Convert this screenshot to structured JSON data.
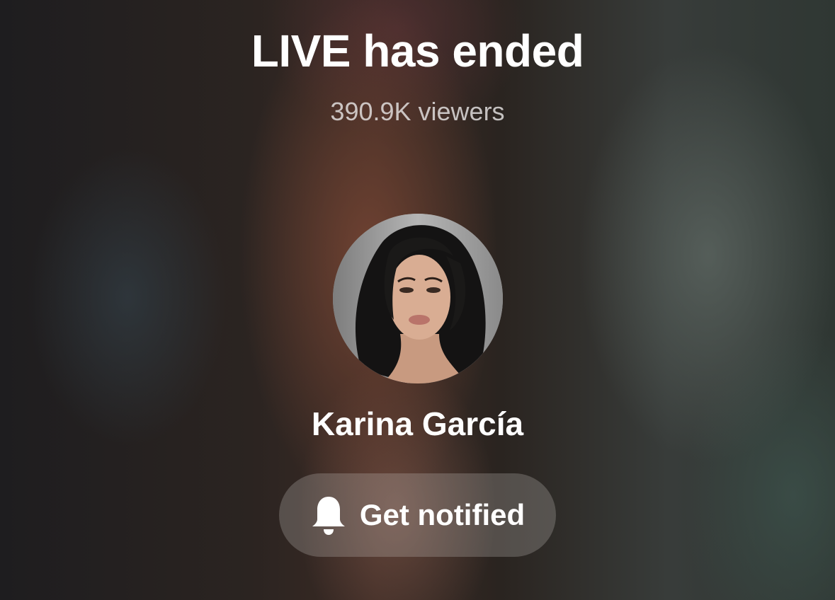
{
  "live": {
    "title": "LIVE has ended",
    "viewers": "390.9K viewers"
  },
  "host": {
    "name": "Karina García",
    "avatar_icon": "profile-photo"
  },
  "notify_button": {
    "label": "Get notified",
    "icon": "bell-icon"
  },
  "colors": {
    "text": "#ffffff",
    "secondary_text": "#e6e4e4",
    "button_bg": "#cdc8c6"
  }
}
